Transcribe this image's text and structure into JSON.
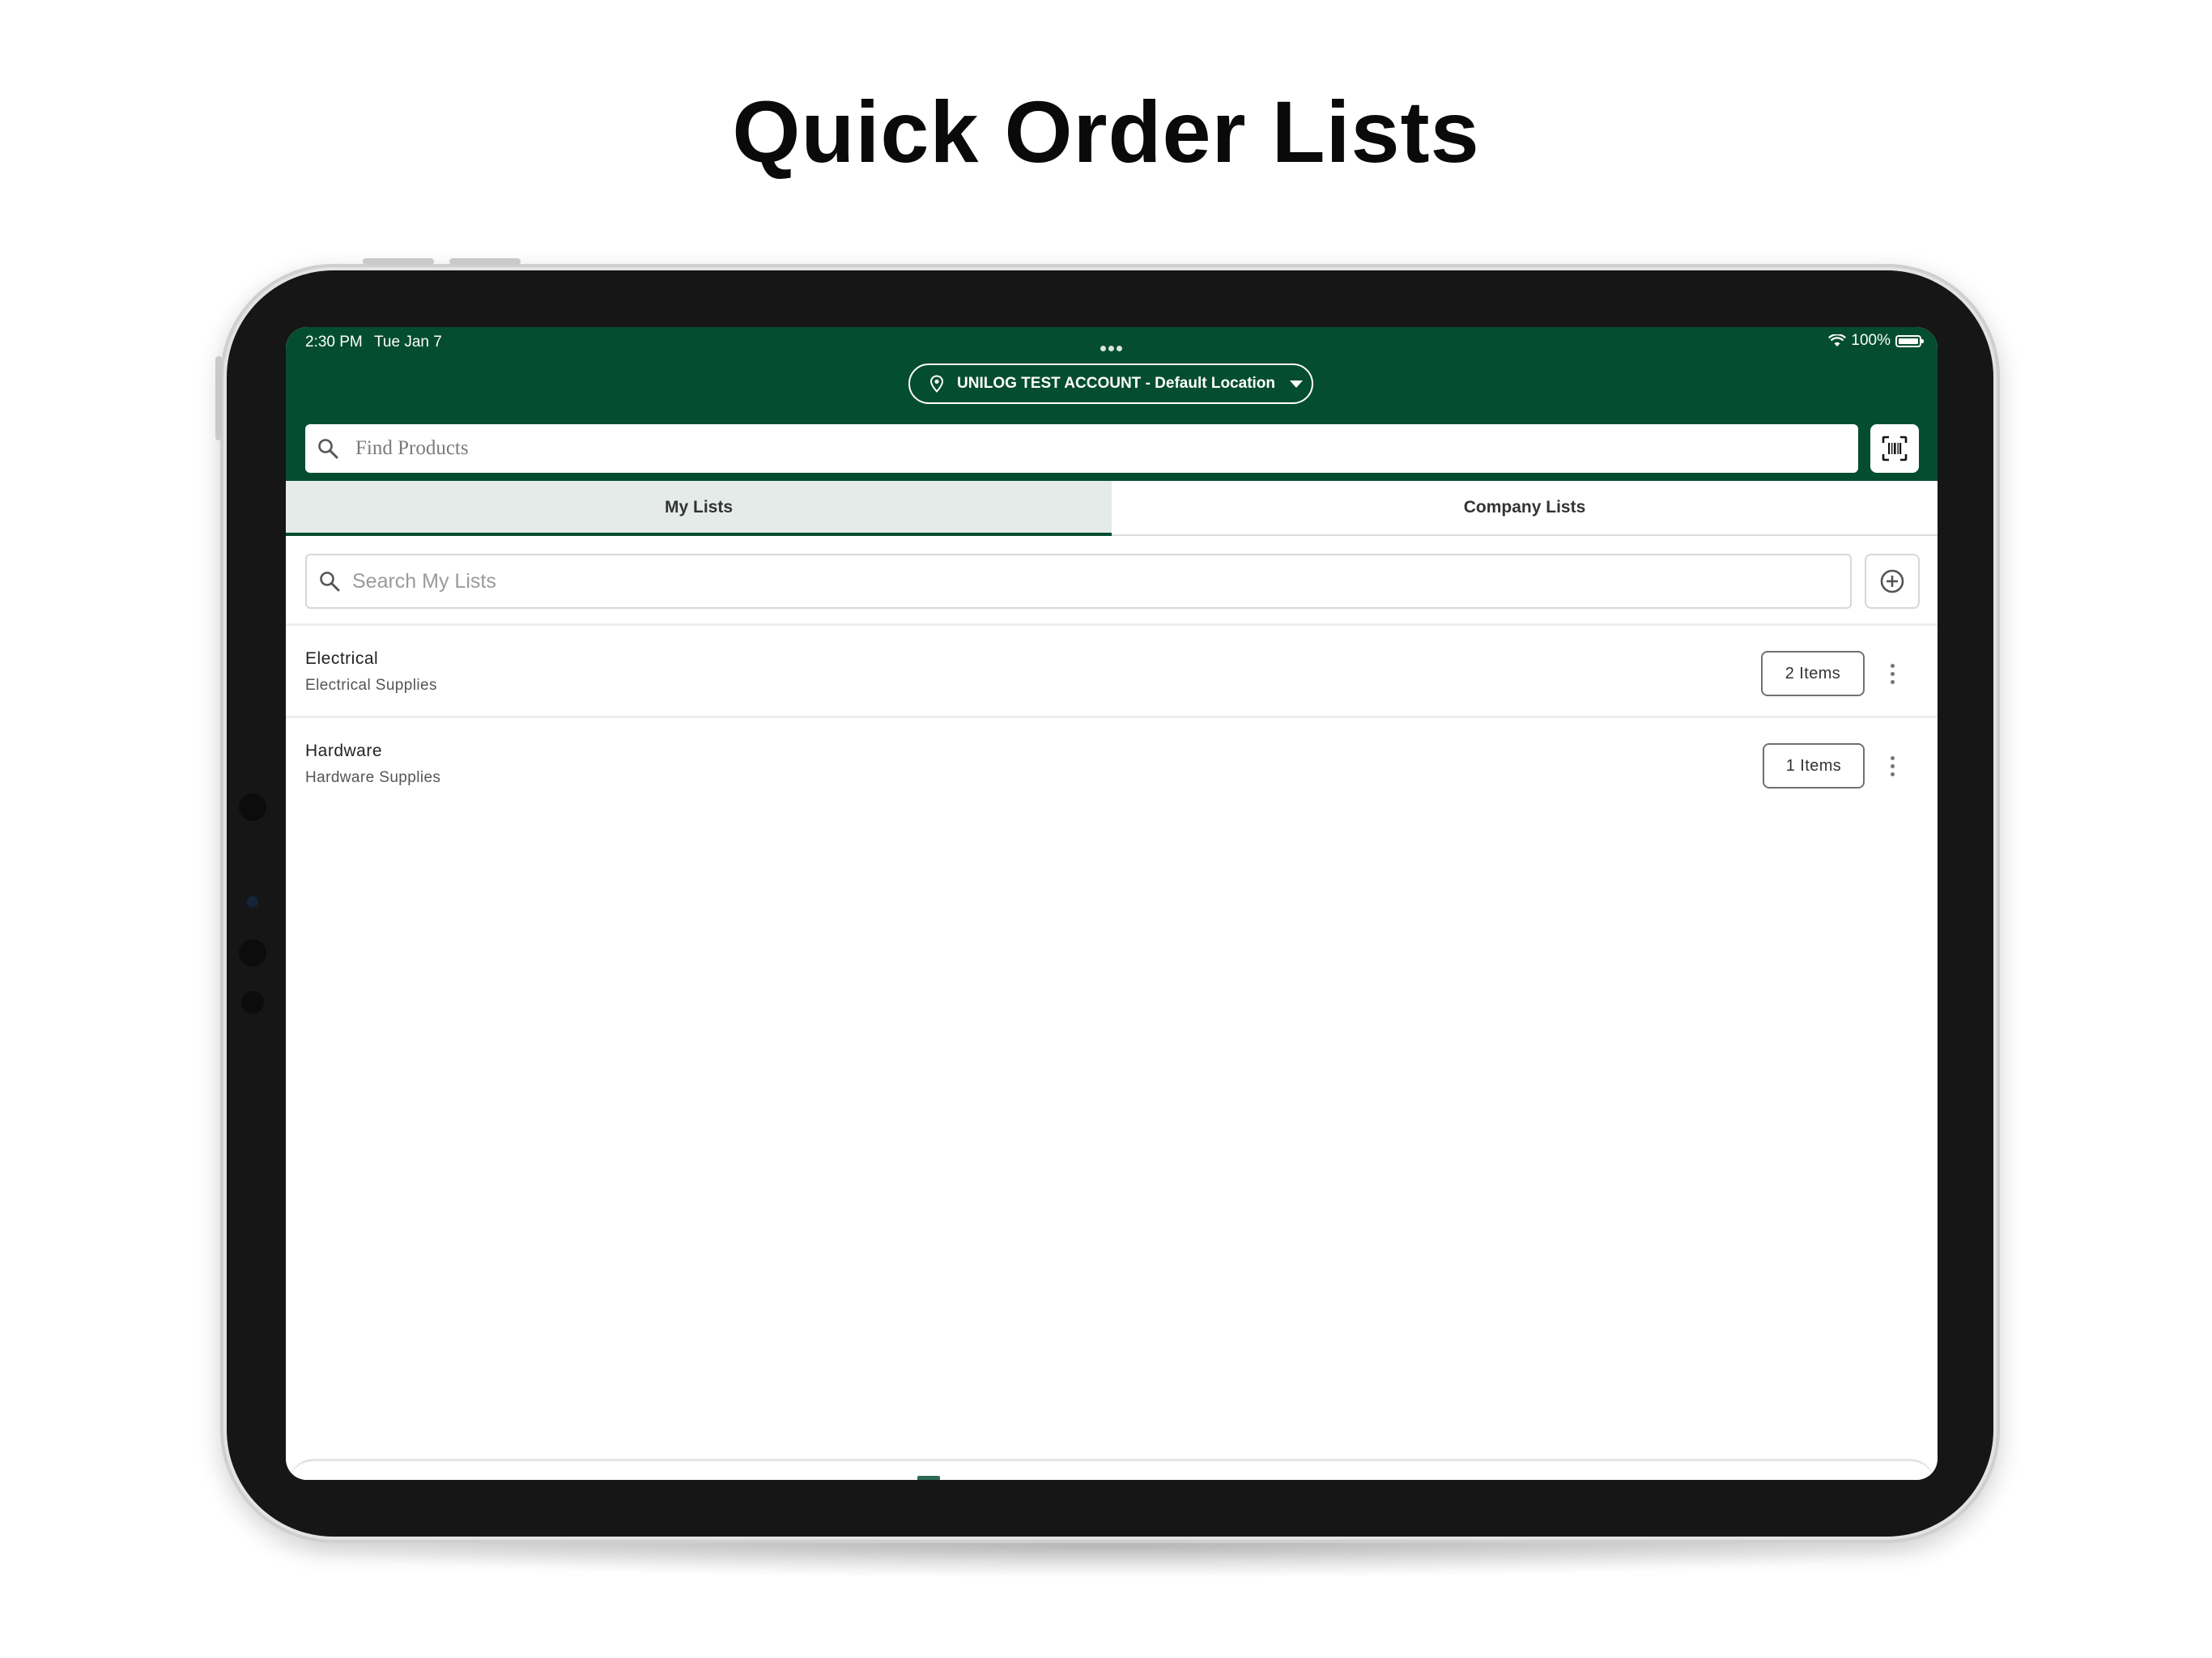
{
  "headline": "Quick Order Lists",
  "status_bar": {
    "time": "2:30 PM",
    "date": "Tue Jan 7",
    "battery": "100%"
  },
  "header": {
    "account_label": "UNILOG TEST ACCOUNT - Default Location",
    "find_placeholder": "Find Products"
  },
  "tabs": [
    {
      "label": "My Lists",
      "active": true
    },
    {
      "label": "Company Lists",
      "active": false
    }
  ],
  "list_search": {
    "placeholder": "Search My Lists"
  },
  "lists": [
    {
      "title": "Electrical",
      "subtitle": "Electrical Supplies",
      "items_label": "2 Items"
    },
    {
      "title": "Hardware",
      "subtitle": "Hardware Supplies",
      "items_label": "1 Items"
    }
  ],
  "colors": {
    "brand_green": "#054d30",
    "active_tab_bg": "#e4ebe8"
  },
  "icons": [
    "location-pin-icon",
    "chevron-down-icon",
    "search-icon",
    "barcode-scan-icon",
    "add-circle-icon",
    "more-vertical-icon",
    "wifi-icon",
    "battery-icon"
  ]
}
